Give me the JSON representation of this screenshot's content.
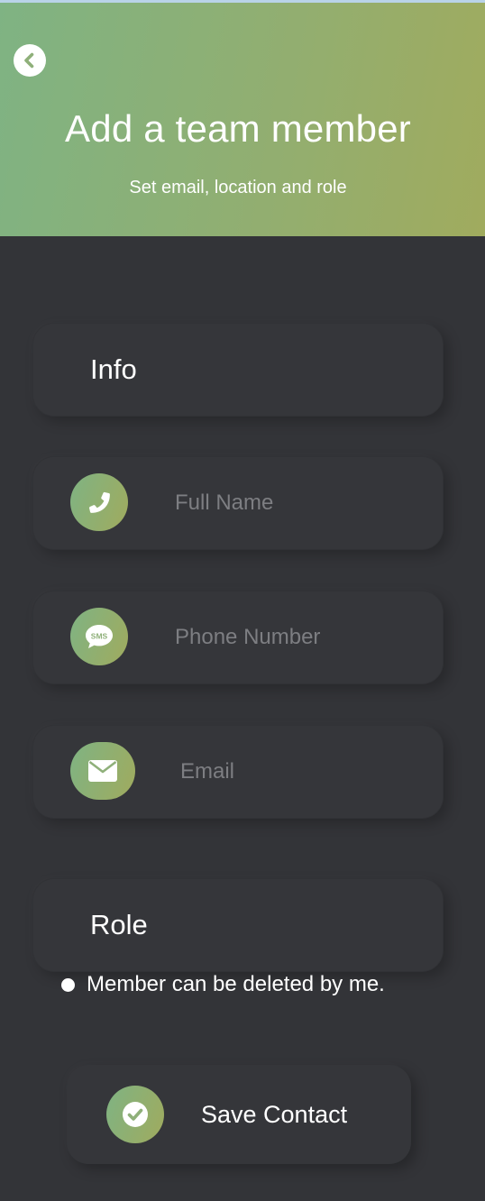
{
  "header": {
    "title": "Add a team member",
    "subtitle": "Set email, location and role",
    "back_icon": "chevron-left-circle-icon"
  },
  "info_section": {
    "title": "Info",
    "fields": [
      {
        "name": "full-name",
        "placeholder": "Full Name",
        "value": "",
        "icon": "phone-icon"
      },
      {
        "name": "phone-number",
        "placeholder": "Phone Number",
        "value": "",
        "icon": "sms-bubble-icon"
      },
      {
        "name": "email",
        "placeholder": "Email",
        "value": "",
        "icon": "envelope-icon"
      }
    ]
  },
  "role_section": {
    "title": "Role",
    "option_label": "Member can be deleted by me."
  },
  "save": {
    "label": "Save Contact",
    "icon": "check-circle-icon"
  },
  "colors": {
    "background": "#333438",
    "card": "#35363a",
    "accent_start": "#7fb383",
    "accent_end": "#a0ab5e",
    "text": "#ffffff",
    "placeholder": "#7d7e82"
  }
}
